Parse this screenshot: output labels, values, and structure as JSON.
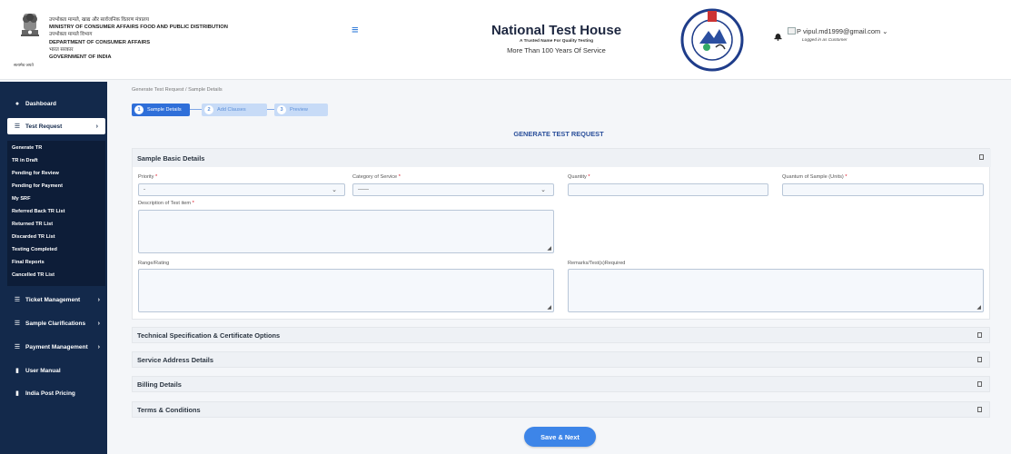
{
  "header": {
    "ministry_hindi": "उपभोक्ता मामले, खाद्य और सार्वजनिक वितरण मंत्रालय",
    "ministry_en": "MINISTRY OF CONSUMER AFFAIRS FOOD AND PUBLIC DISTRIBUTION",
    "dept_hindi": "उपभोक्ता मामले विभाग",
    "dept_en": "DEPARTMENT OF CONSUMER AFFAIRS",
    "gov_hindi": "भारत सरकार",
    "gov_en": "GOVERNMENT OF INDIA",
    "emblem_caption": "सत्यमेव जयते",
    "org_title": "National Test House",
    "org_tagline": "A Trusted Name For Quality Testing",
    "org_sub": "More Than 100 Years Of Service",
    "seal_text": "NATIONAL TEST HOUSE",
    "user_email": "vipul.md1999@gmail.com",
    "user_role": "Logged in as Customer",
    "user_pic_alt": "P"
  },
  "sidebar": {
    "items": [
      {
        "label": "Dashboard",
        "icon": "dashboard-icon"
      },
      {
        "label": "Test Request",
        "icon": "list-icon"
      },
      {
        "label": "Ticket Management",
        "icon": "list-icon"
      },
      {
        "label": "Sample Clarifications",
        "icon": "list-icon"
      },
      {
        "label": "Payment Management",
        "icon": "list-icon"
      },
      {
        "label": "User Manual",
        "icon": "book-icon"
      },
      {
        "label": "India Post Pricing",
        "icon": "book-icon"
      }
    ],
    "submenu": [
      "Generate TR",
      "TR in Draft",
      "Pending for Review",
      "Pending for Payment",
      "My SRF",
      "Referred Back TR List",
      "Returned TR List",
      "Discarded TR List",
      "Testing Completed",
      "Final Reports",
      "Cancelled TR List"
    ]
  },
  "breadcrumb": "Generate Test Request  /  Sample Details",
  "steps": [
    {
      "num": "1",
      "label": "Sample Details"
    },
    {
      "num": "2",
      "label": "Add Clauses"
    },
    {
      "num": "3",
      "label": "Preview"
    }
  ],
  "page_title": "GENERATE TEST REQUEST",
  "basic": {
    "title": "Sample Basic Details",
    "priority_label": "Priority",
    "priority_value": "-",
    "category_label": "Category of Service",
    "category_value": "------",
    "quantity_label": "Quantity",
    "quantum_label": "Quantum of Sample (Units)",
    "description_label": "Description of Test item",
    "range_label": "Range/Rating",
    "remarks_label": "Remarks/Test(s)Required",
    "required_mark": "*"
  },
  "sections": [
    "Technical Specification & Certificate Options",
    "Service Address Details",
    "Billing Details",
    "Terms & Conditions"
  ],
  "save_label": "Save & Next",
  "colors": {
    "sidebar": "#13294b",
    "accent": "#2f6fd9",
    "required": "#dd1122"
  }
}
